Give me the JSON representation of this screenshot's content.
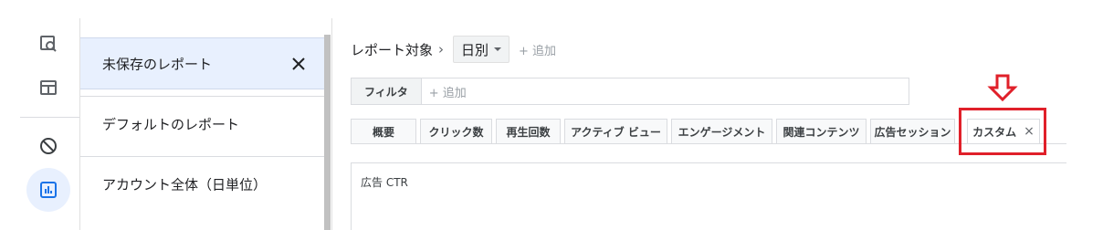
{
  "rail": {
    "icons": [
      "search-report-icon",
      "layout-icon",
      "block-icon",
      "report-chart-icon"
    ]
  },
  "report_list": {
    "items": [
      {
        "label": "未保存のレポート",
        "active": true
      },
      {
        "label": "デフォルトのレポート",
        "active": false
      },
      {
        "label": "アカウント全体（日単位）",
        "active": false
      }
    ]
  },
  "scope": {
    "label": "レポート対象",
    "dimension": "日別",
    "add": "+ 追加"
  },
  "filter": {
    "button": "フィルタ",
    "add": "+ 追加"
  },
  "tabs": [
    {
      "label": "概要"
    },
    {
      "label": "クリック数"
    },
    {
      "label": "再生回数"
    },
    {
      "label": "アクティブ ビュー"
    },
    {
      "label": "エンゲージメント"
    },
    {
      "label": "関連コンテンツ"
    },
    {
      "label": "広告セッション"
    },
    {
      "label": "カスタム",
      "active": true,
      "close": "×"
    }
  ],
  "content": {
    "metric": "広告 CTR"
  },
  "colors": {
    "highlight": "#e0202a",
    "active_bg": "#e8f0fe"
  }
}
